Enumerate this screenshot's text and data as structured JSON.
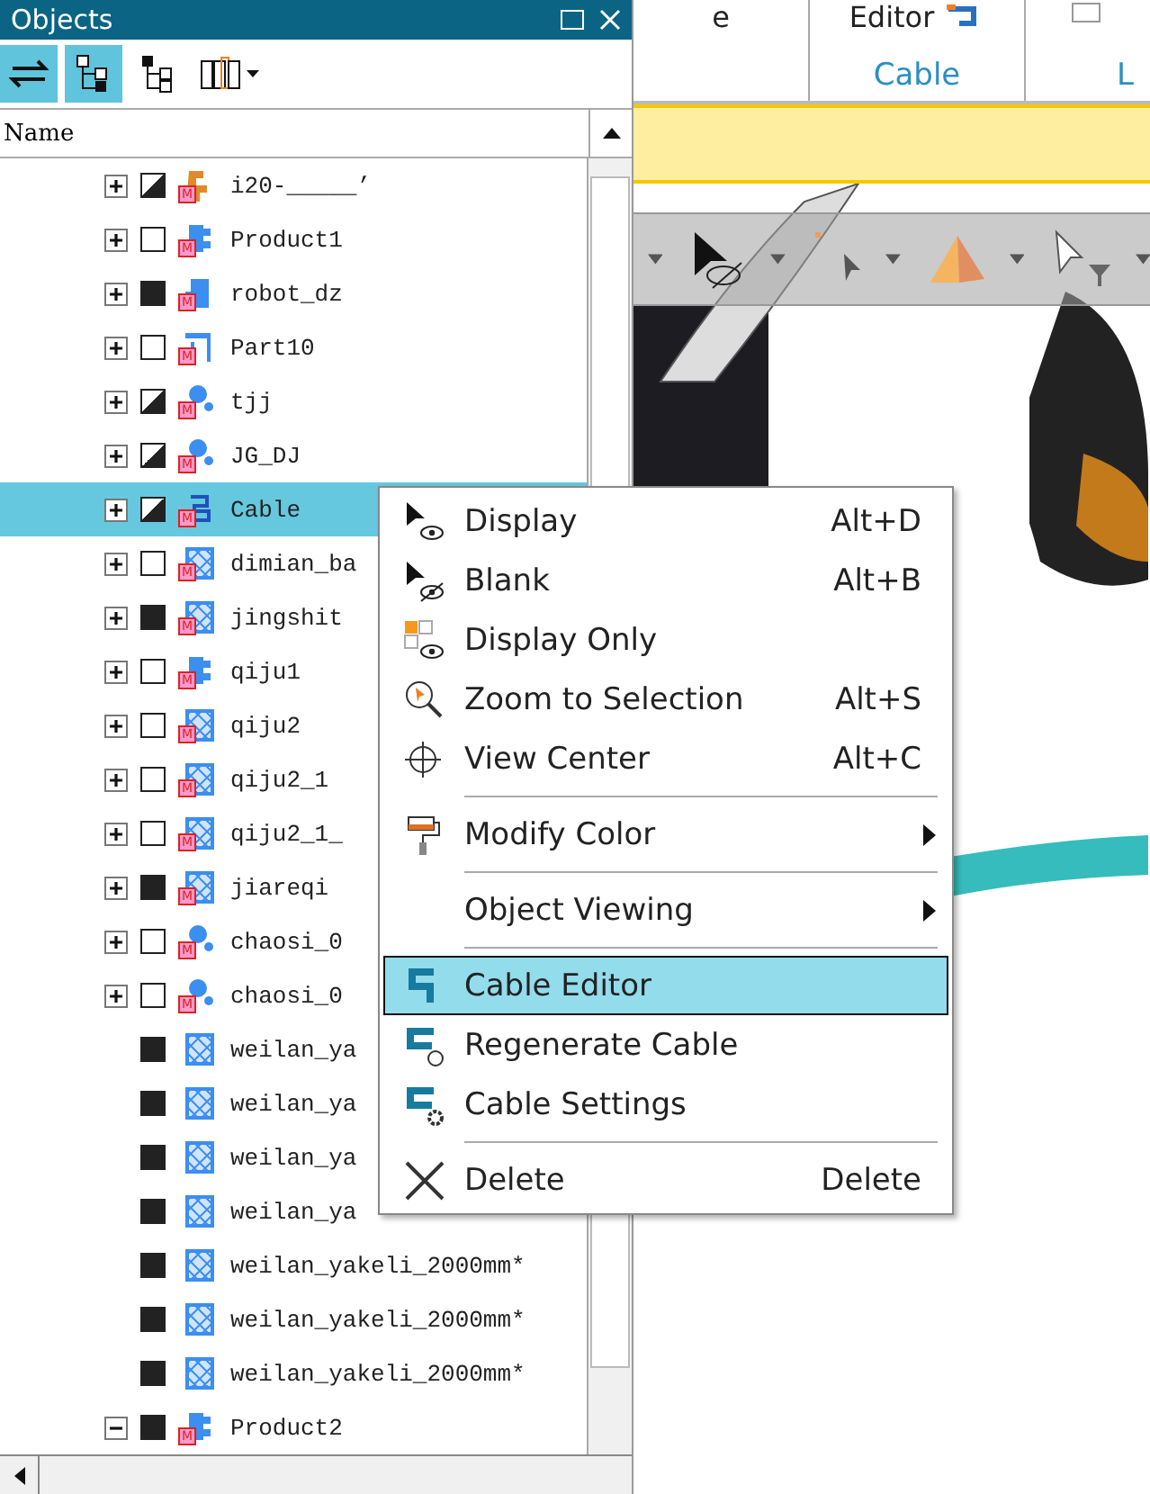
{
  "panel": {
    "title": "Objects",
    "header": "Name",
    "rows": [
      {
        "name": "i20-_____’",
        "expandable": true,
        "expanded": false,
        "visible": true,
        "mixed": true,
        "kind": "robot",
        "badge": "M",
        "selected": false
      },
      {
        "name": "Product1",
        "expandable": true,
        "expanded": false,
        "visible": false,
        "mixed": false,
        "kind": "product",
        "badge": "M",
        "selected": false
      },
      {
        "name": "robot_dz",
        "expandable": true,
        "expanded": false,
        "visible": true,
        "mixed": false,
        "kind": "part",
        "badge": "M",
        "selected": false
      },
      {
        "name": "Part10",
        "expandable": true,
        "expanded": false,
        "visible": false,
        "mixed": false,
        "kind": "table",
        "badge": "M",
        "selected": false
      },
      {
        "name": "tjj",
        "expandable": true,
        "expanded": false,
        "visible": true,
        "mixed": true,
        "kind": "dots",
        "badge": "M",
        "selected": false
      },
      {
        "name": "JG_DJ",
        "expandable": true,
        "expanded": false,
        "visible": true,
        "mixed": true,
        "kind": "dots",
        "badge": "M",
        "selected": false
      },
      {
        "name": "Cable",
        "expandable": true,
        "expanded": false,
        "visible": true,
        "mixed": true,
        "kind": "cable",
        "badge": "M",
        "selected": true
      },
      {
        "name": "dimian_ba",
        "expandable": true,
        "expanded": false,
        "visible": false,
        "mixed": false,
        "kind": "mesh",
        "badge": "M",
        "selected": false
      },
      {
        "name": "jingshit",
        "expandable": true,
        "expanded": false,
        "visible": true,
        "mixed": false,
        "kind": "mesh",
        "badge": "M",
        "selected": false
      },
      {
        "name": "qiju1",
        "expandable": true,
        "expanded": false,
        "visible": false,
        "mixed": false,
        "kind": "product",
        "badge": "M",
        "selected": false
      },
      {
        "name": "qiju2",
        "expandable": true,
        "expanded": false,
        "visible": false,
        "mixed": false,
        "kind": "mesh",
        "badge": "M",
        "selected": false
      },
      {
        "name": "qiju2_1",
        "expandable": true,
        "expanded": false,
        "visible": false,
        "mixed": false,
        "kind": "mesh",
        "badge": "M",
        "selected": false
      },
      {
        "name": "qiju2_1_",
        "expandable": true,
        "expanded": false,
        "visible": false,
        "mixed": false,
        "kind": "mesh",
        "badge": "M",
        "selected": false
      },
      {
        "name": "jiareqi",
        "expandable": true,
        "expanded": false,
        "visible": true,
        "mixed": false,
        "kind": "mesh",
        "badge": "M",
        "selected": false
      },
      {
        "name": "chaosi_0",
        "expandable": true,
        "expanded": false,
        "visible": false,
        "mixed": false,
        "kind": "dots",
        "badge": "M",
        "selected": false
      },
      {
        "name": "chaosi_0",
        "expandable": true,
        "expanded": false,
        "visible": false,
        "mixed": false,
        "kind": "dots",
        "badge": "M",
        "selected": false
      },
      {
        "name": "weilan_ya",
        "expandable": false,
        "visible": true,
        "mixed": false,
        "kind": "mesh",
        "selected": false
      },
      {
        "name": "weilan_ya",
        "expandable": false,
        "visible": true,
        "mixed": false,
        "kind": "mesh",
        "selected": false
      },
      {
        "name": "weilan_ya",
        "expandable": false,
        "visible": true,
        "mixed": false,
        "kind": "mesh",
        "selected": false
      },
      {
        "name": "weilan_ya",
        "expandable": false,
        "visible": true,
        "mixed": false,
        "kind": "mesh",
        "selected": false
      },
      {
        "name": "weilan_yakeli_2000mm*",
        "expandable": false,
        "visible": true,
        "mixed": false,
        "kind": "mesh",
        "selected": false
      },
      {
        "name": "weilan_yakeli_2000mm*",
        "expandable": false,
        "visible": true,
        "mixed": false,
        "kind": "mesh",
        "selected": false
      },
      {
        "name": "weilan_yakeli_2000mm*",
        "expandable": false,
        "visible": true,
        "mixed": false,
        "kind": "mesh",
        "selected": false
      },
      {
        "name": "Product2",
        "expandable": true,
        "expanded": true,
        "visible": true,
        "mixed": false,
        "kind": "product",
        "badge": "M",
        "selected": false
      }
    ]
  },
  "ribbon": {
    "cut_label": "e",
    "button": "Editor",
    "group_label": "Cable",
    "next_group_label": "L"
  },
  "context_menu": [
    {
      "kind": "display",
      "label": "Display",
      "shortcut": "Alt+D",
      "submenu": false,
      "selected": false
    },
    {
      "kind": "blank",
      "label": "Blank",
      "shortcut": "Alt+B",
      "submenu": false,
      "selected": false
    },
    {
      "kind": "display-only",
      "label": "Display Only",
      "submenu": false,
      "selected": false
    },
    {
      "kind": "zoom",
      "label": "Zoom to Selection",
      "shortcut": "Alt+S",
      "submenu": false,
      "selected": false
    },
    {
      "kind": "crosshair",
      "label": "View Center",
      "shortcut": "Alt+C",
      "submenu": false,
      "selected": false
    },
    {
      "kind": "separator"
    },
    {
      "kind": "paint",
      "label": "Modify Color",
      "submenu": true,
      "selected": false
    },
    {
      "kind": "separator"
    },
    {
      "kind": "plain",
      "label": "Object Viewing",
      "submenu": true,
      "selected": false
    },
    {
      "kind": "separator"
    },
    {
      "kind": "cable",
      "label": "Cable Editor",
      "submenu": false,
      "selected": true
    },
    {
      "kind": "cable-refresh",
      "label": "Regenerate Cable",
      "submenu": false,
      "selected": false
    },
    {
      "kind": "cable-gear",
      "label": "Cable Settings",
      "submenu": false,
      "selected": false
    },
    {
      "kind": "separator"
    },
    {
      "kind": "delete",
      "label": "Delete",
      "shortcut": "Delete",
      "submenu": false,
      "selected": false
    }
  ]
}
